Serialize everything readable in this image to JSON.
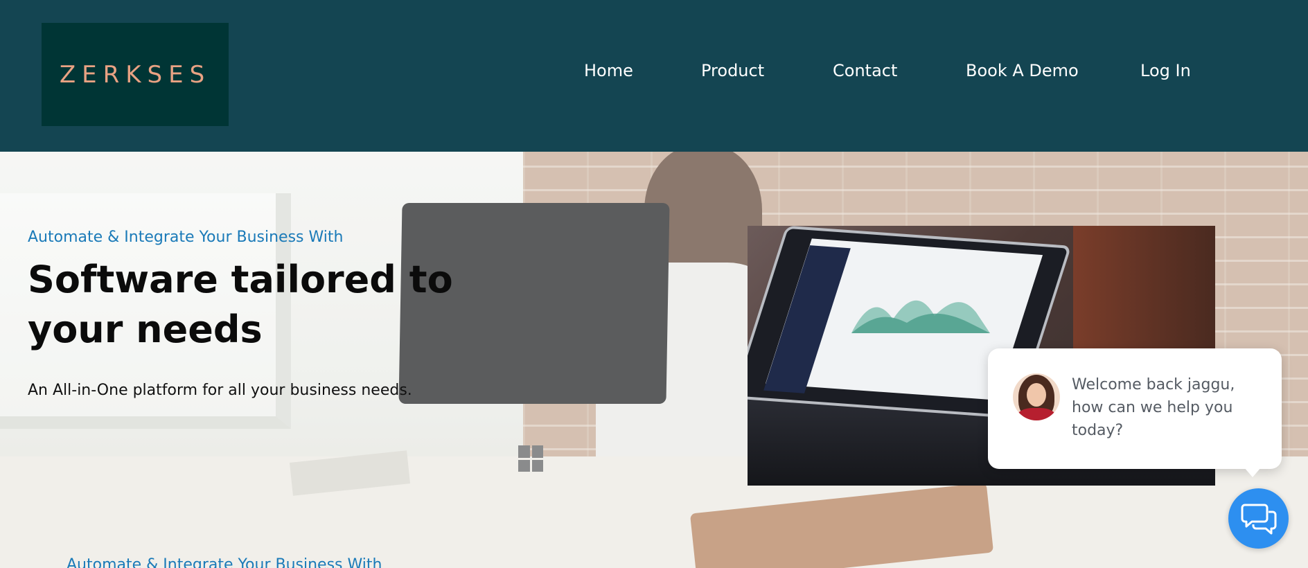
{
  "header": {
    "logo_text": "ZERKSES",
    "nav": [
      {
        "label": "Home"
      },
      {
        "label": "Product"
      },
      {
        "label": "Contact"
      },
      {
        "label": "Book A Demo"
      },
      {
        "label": "Log In"
      }
    ]
  },
  "hero": {
    "eyebrow": "Automate & Integrate Your Business With",
    "headline": "Software tailored to your needs",
    "subtext": "An All-in-One platform for all your business needs.",
    "eyebrow_repeat": "Automate & Integrate Your Business With"
  },
  "chat": {
    "message": "Welcome back jaggu, how can we help you today?",
    "button_icon": "chat-bubbles-icon",
    "avatar_icon": "agent-avatar"
  },
  "colors": {
    "header_bg": "#144552",
    "logo_bg": "#003535",
    "logo_text": "#e9a283",
    "accent_blue": "#1a7ab8",
    "chat_button": "#2d8ff0"
  }
}
